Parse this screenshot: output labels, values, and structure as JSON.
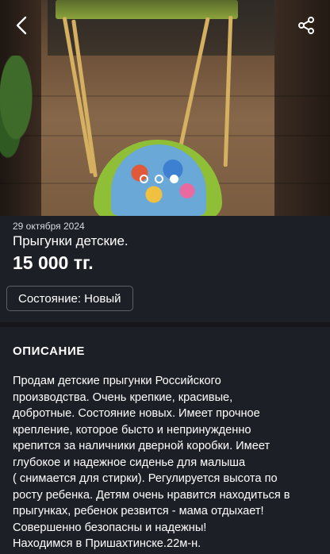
{
  "listing": {
    "date": "29 октября 2024",
    "title": "Прыгунки детские.",
    "price": "15 000 тг.",
    "condition_chip": "Состояние: Новый"
  },
  "gallery": {
    "photo_count": 3,
    "active_index": 2
  },
  "description": {
    "heading": "ОПИСАНИЕ",
    "text": "Продам детские прыгунки Российского\nпроизводства. Очень крепкие, красивые,\nдобротные. Состояние новых. Имеет прочное\nкрепление, которое бысто и непринужденно\nкрепится за наличники дверной коробки. Имеет\nглубокое и надежное сиденье для малыша\n( снимается для стирки). Регулируется высота по\nросту ребенка. Детям очень нравится находиться в\nпрыгунках, ребенок резвится - мама отдыхает!\nСовершенно безопасны и надежны!\nНаходимся в Пришахтинске.22м-н."
  },
  "icons": {
    "back": "chevron-left-icon",
    "share": "share-icon"
  },
  "colors": {
    "background": "#1c1f26",
    "text": "#ffffff",
    "chip_border": "#5a5f69"
  }
}
